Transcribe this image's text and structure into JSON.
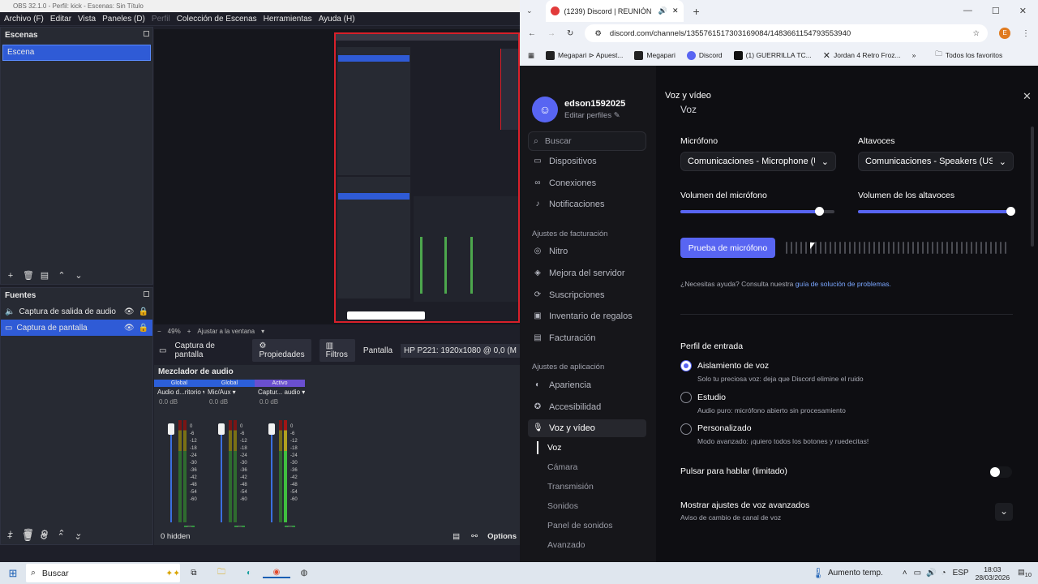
{
  "obs": {
    "title": "OBS 32.1.0 - Perfil: kick - Escenas: Sin Título",
    "menu": [
      "Archivo (F)",
      "Editar",
      "Vista",
      "Paneles (D)",
      "Perfil",
      "Colección de Escenas",
      "Herramientas",
      "Ayuda (H)"
    ],
    "scenes": {
      "title": "Escenas",
      "items": [
        "Escena"
      ]
    },
    "sources": {
      "title": "Fuentes",
      "items": [
        {
          "label": "Captura de salida de audio",
          "selected": false
        },
        {
          "label": "Captura de pantalla",
          "selected": true
        }
      ]
    },
    "zoom": {
      "value": "49%",
      "fit_label": "Ajustar a la ventana"
    },
    "props_bar": {
      "source": "Captura de pantalla",
      "properties": "Propiedades",
      "filters": "Filtros",
      "screen_label": "Pantalla",
      "screen_value": "HP P221: 1920x1080 @ 0,0 (M"
    },
    "mixer": {
      "title": "Mezclador de audio",
      "hidden_label": "0 hidden",
      "options_label": "Options",
      "scale": [
        "0",
        "-6",
        "-12",
        "-18",
        "-24",
        "-30",
        "-36",
        "-42",
        "-48",
        "-54",
        "-60"
      ],
      "channels": [
        {
          "tag": "Global",
          "name": "Audio d...ritorio",
          "db": "0.0 dB",
          "tag_color": "#2c5fd9"
        },
        {
          "tag": "Global",
          "name": "Mic/Aux",
          "db": "0.0 dB",
          "tag_color": "#2c5fd9"
        },
        {
          "tag": "Activo",
          "name": "Captur... audio",
          "db": "0.0 dB",
          "tag_color": "#6a4fd0"
        }
      ]
    }
  },
  "chrome": {
    "tab_title": "(1239) Discord | REUNIÓN",
    "url": "discord.com/channels/1355761517303169084/1483661154793553940",
    "avatar_letter": "E",
    "bookmarks": [
      "Megapari ⊳ Apuest...",
      "Megapari",
      "Discord",
      "(1) GUERRILLA TC...",
      "Jordan 4 Retro Froz..."
    ],
    "bookmarks_more": "»",
    "all_favorites": "Todos los favoritos"
  },
  "discord": {
    "username": "edson1592025",
    "edit_profiles": "Editar perfiles",
    "search_placeholder": "Buscar",
    "nav_top": [
      "Dispositivos",
      "Conexiones",
      "Notificaciones"
    ],
    "billing_section": "Ajustes de facturación",
    "nav_billing": [
      "Nitro",
      "Mejora del servidor",
      "Suscripciones",
      "Inventario de regalos",
      "Facturación"
    ],
    "app_section": "Ajustes de aplicación",
    "nav_app": [
      "Apariencia",
      "Accesibilidad",
      "Voz y vídeo"
    ],
    "sub_nav": [
      "Voz",
      "Cámara",
      "Transmisión",
      "Sonidos",
      "Panel de sonidos",
      "Avanzado"
    ],
    "header": "Voz y vídeo",
    "section_cut": "Voz",
    "mic_label": "Micrófono",
    "mic_value": "Comunicaciones - Microphone (US",
    "speaker_label": "Altavoces",
    "speaker_value": "Comunicaciones - Speakers (USB",
    "mic_volume_label": "Volumen del micrófono",
    "speaker_volume_label": "Volumen de los altavoces",
    "mic_volume": 0.9,
    "speaker_volume": 0.99,
    "test_button": "Prueba de micrófono",
    "help_prefix": "¿Necesitas ayuda? Consulta nuestra ",
    "help_link": "guía de solución de problemas.",
    "input_profile_title": "Perfil de entrada",
    "profiles": [
      {
        "title": "Aislamiento de voz",
        "desc": "Solo tu preciosa voz: deja que Discord elimine el ruido",
        "selected": true
      },
      {
        "title": "Estudio",
        "desc": "Audio puro: micrófono abierto sin procesamiento",
        "selected": false
      },
      {
        "title": "Personalizado",
        "desc": "Modo avanzado: ¡quiero todos los botones y ruedecitas!",
        "selected": false
      }
    ],
    "ptt_label": "Pulsar para hablar (limitado)",
    "advanced_title": "Mostrar ajustes de voz avanzados",
    "advanced_desc": "Aviso de cambio de canal de voz"
  },
  "taskbar": {
    "search_placeholder": "Buscar",
    "weather": "Aumento temp.",
    "lang": "ESP",
    "time": "18:03",
    "date": "28/03/2026",
    "notif_count": "10"
  },
  "colors": {
    "discord_accent": "#5865f2",
    "obs_select": "#2f5bd6",
    "chrome_bg": "#eef1f7"
  }
}
